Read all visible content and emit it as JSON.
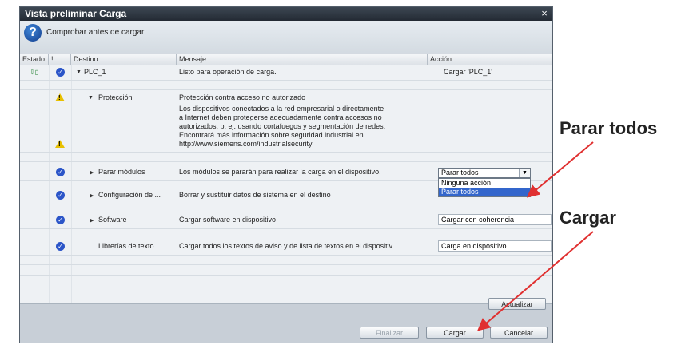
{
  "dialog": {
    "title": "Vista preliminar Carga",
    "close_label": "×",
    "header_text": "Comprobar antes de cargar"
  },
  "columns": [
    "Estado",
    "!",
    "Destino",
    "Mensaje",
    "Acción"
  ],
  "rows": [
    {
      "destino": "PLC_1",
      "mensaje": "Listo para operación de carga.",
      "accion": "Cargar 'PLC_1'"
    },
    {
      "destino": "Protección",
      "mensaje": "Protección contra acceso no autorizado",
      "accion": ""
    },
    {
      "destino": "",
      "mensaje_lines": [
        "Los dispositivos conectados a la red empresarial o directamente",
        "a Internet deben protegerse adecuadamente contra accesos no",
        "autorizados, p. ej. usando cortafuegos y segmentación de redes.",
        "Encontrará más información sobre seguridad industrial en",
        "http://www.siemens.com/industrialsecurity"
      ]
    },
    {
      "destino": "Parar módulos",
      "mensaje": "Los módulos se pararán para realizar la carga en el dispositivo.",
      "accion": "Parar todos"
    },
    {
      "destino": "Configuración de ...",
      "mensaje": "Borrar y sustituir datos de sistema en el destino",
      "accion": ""
    },
    {
      "destino": "Software",
      "mensaje": "Cargar software en dispositivo",
      "accion": "Cargar con coherencia"
    },
    {
      "destino": "Librerías de texto",
      "mensaje": "Cargar todos los textos de aviso y de lista de textos en el dispositiv",
      "accion": "Carga en dispositivo ..."
    }
  ],
  "dropdown": {
    "selected": "Parar todos",
    "options": [
      "Ninguna acción",
      "Parar todos"
    ]
  },
  "buttons": {
    "refresh": "Actualizar",
    "finish": "Finalizar",
    "load": "Cargar",
    "cancel": "Cancelar"
  },
  "annotations": {
    "stop_all": "Parar todos",
    "load": "Cargar"
  },
  "colors": {
    "arrow": "#e03030",
    "selection": "#3366cc"
  }
}
